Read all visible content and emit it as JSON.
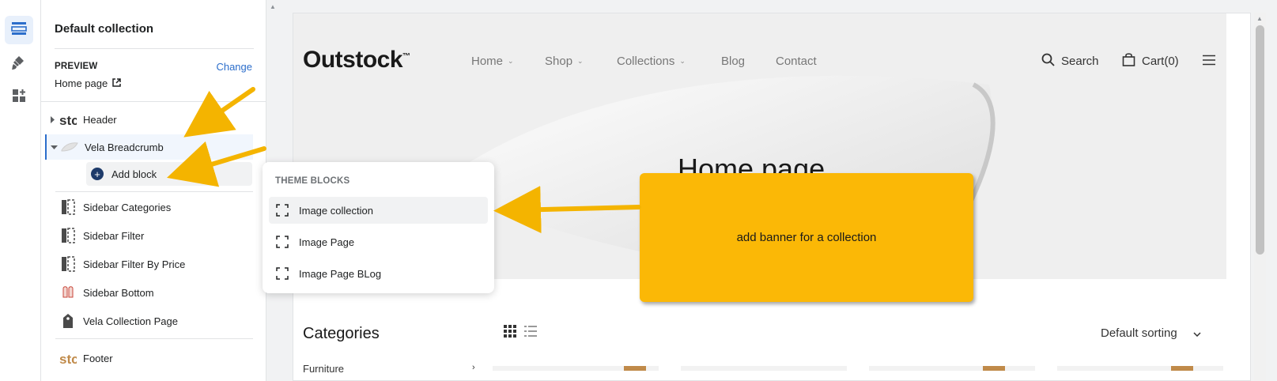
{
  "sidebar": {
    "title": "Default collection",
    "preview_label": "PREVIEW",
    "change_label": "Change",
    "preview_value": "Home page",
    "items": [
      {
        "label": "Header"
      },
      {
        "label": "Vela Breadcrumb"
      },
      {
        "label": "Sidebar Categories"
      },
      {
        "label": "Sidebar Filter"
      },
      {
        "label": "Sidebar Filter By Price"
      },
      {
        "label": "Sidebar Bottom"
      },
      {
        "label": "Vela Collection Page"
      },
      {
        "label": "Footer"
      }
    ],
    "add_block_label": "Add block"
  },
  "popover": {
    "heading": "THEME BLOCKS",
    "items": [
      {
        "label": "Image collection"
      },
      {
        "label": "Image Page"
      },
      {
        "label": "Image Page BLog"
      }
    ]
  },
  "callout": {
    "text": "add banner for a collection",
    "color": "#fbb806"
  },
  "store": {
    "logo": "Outstock",
    "logo_mark": "™",
    "nav": [
      {
        "label": "Home"
      },
      {
        "label": "Shop"
      },
      {
        "label": "Collections"
      },
      {
        "label": "Blog"
      },
      {
        "label": "Contact"
      }
    ],
    "search_label": "Search",
    "cart_label": "Cart(0)",
    "hero_title": "Home page",
    "categories_title": "Categories",
    "sort_label": "Default sorting",
    "first_category": "Furniture"
  },
  "colors": {
    "accent": "#2c6ecb",
    "annotation_arrow": "#f4b400",
    "product_tag": "#c08a49"
  }
}
